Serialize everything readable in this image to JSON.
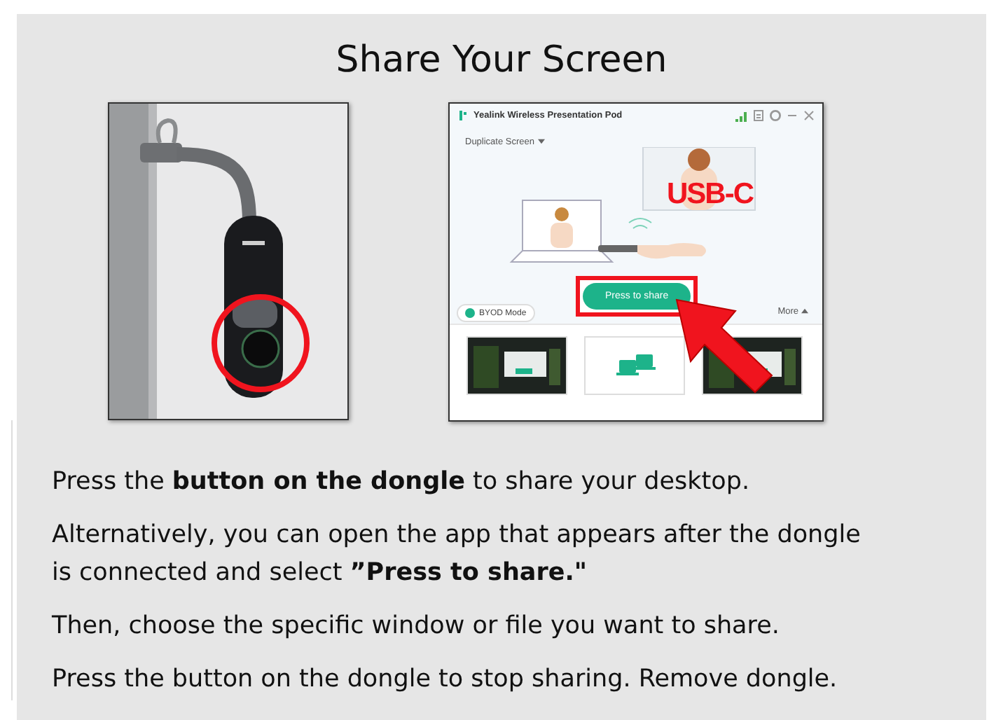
{
  "page": {
    "title": "Share Your Screen"
  },
  "app_window": {
    "title": "Yealink Wireless Presentation Pod",
    "mode_menu": "Duplicate Screen",
    "overlay_label": "USB-C",
    "share_button": "Press to share",
    "byod_mode": {
      "label": "BYOD Mode",
      "checked": true
    },
    "more": "More",
    "thumbnails": [
      {
        "kind": "screen"
      },
      {
        "kind": "devices"
      },
      {
        "kind": "screen"
      }
    ]
  },
  "instructions": [
    "Press the **button on the dongle** to share your desktop.",
    "Alternatively, you can open the app that appears after the dongle is connected and select **”Press to share.\"**",
    "Then, choose the specific window or file you want to share.",
    "Press the button on the dongle to stop sharing.  Remove dongle."
  ]
}
